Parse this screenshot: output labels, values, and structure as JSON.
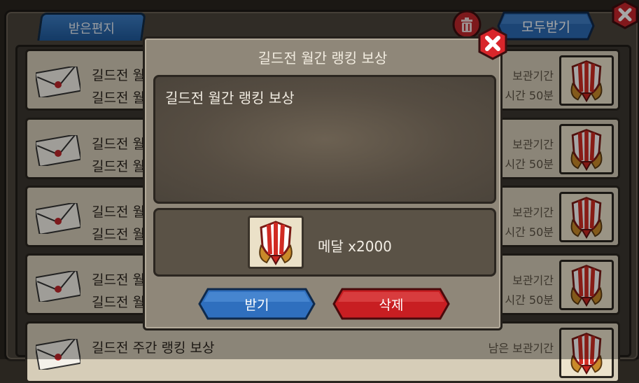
{
  "mailbox": {
    "tab_label": "받은편지",
    "receive_all_label": "모두받기"
  },
  "mails": [
    {
      "title": "길드전 월",
      "subtitle": "길드전 월",
      "keep_label": "보관기간",
      "keep_time": "시간 50분"
    },
    {
      "title": "길드전 월",
      "subtitle": "길드전 월",
      "keep_label": "보관기간",
      "keep_time": "시간 50분"
    },
    {
      "title": "길드전 월",
      "subtitle": "길드전 월",
      "keep_label": "보관기간",
      "keep_time": "시간 50분"
    },
    {
      "title": "길드전 월",
      "subtitle": "길드전 월",
      "keep_label": "보관기간",
      "keep_time": "시간 50분"
    },
    {
      "title": "길드전 주간 랭킹 보상",
      "subtitle": "",
      "keep_label": "남은 보관기간",
      "keep_time": ""
    }
  ],
  "modal": {
    "title": "길드전 월간 랭킹 보상",
    "body": "길드전 월간 랭킹 보상",
    "reward_text": "메달 x2000",
    "receive_label": "받기",
    "delete_label": "삭제"
  },
  "icons": {
    "close": "close-icon",
    "trash": "trash-icon",
    "envelope": "envelope-icon",
    "medal": "medal-icon"
  },
  "colors": {
    "blue_button": "#2f6fbe",
    "red_button": "#c81e22",
    "close_red": "#d9262b"
  }
}
